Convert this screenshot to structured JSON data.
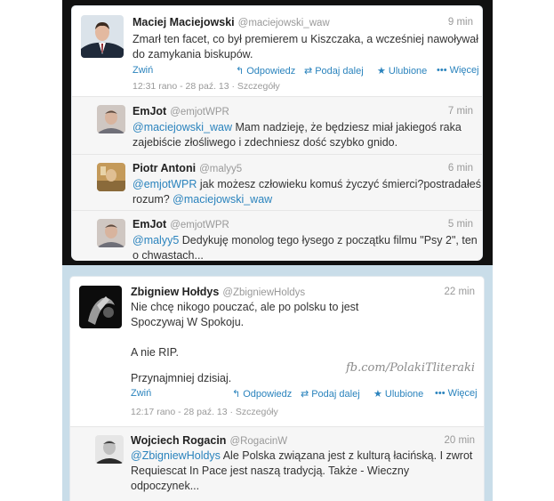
{
  "top_panel": {
    "tweet": {
      "name": "Maciej Maciejowski",
      "handle": "@maciejowski_waw",
      "time": "9 min",
      "line1": "Zmarł ten facet, co był premierem u Kiszczaka, a wcześniej nawoływał",
      "line2": "do zamykania biskupów.",
      "collapse": "Zwiń",
      "reply": "Odpowiedz",
      "retweet": "Podaj dalej",
      "favorite": "Ulubione",
      "more": "Więcej",
      "meta": "12:31 rano - 28 paź. 13 · Szczegóły"
    },
    "replies": [
      {
        "name": "EmJot",
        "handle": "@emjotWPR",
        "time": "7 min",
        "line1_mention": "@maciejowski_waw",
        "line1_text": " Mam nadzieję, że będziesz miał jakiegoś raka",
        "line2": "zajebiście złośliwego i zdechniesz dość szybko gnido."
      },
      {
        "name": "Piotr Antoni",
        "handle": "@malyy5",
        "time": "6 min",
        "line1_mention": "@emjotWPR",
        "line1_text": " jak możesz człowieku komuś życzyć śmierci?postradałeś",
        "line2_text": "rozum? ",
        "line2_mention": "@maciejowski_waw"
      },
      {
        "name": "EmJot",
        "handle": "@emjotWPR",
        "time": "5 min",
        "line1_mention": "@malyy5",
        "line1_text": " Dedykuję monolog tego łysego z początku filmu \"Psy 2\", ten",
        "line2": "o chwastach..."
      }
    ]
  },
  "bottom_panel": {
    "tweet": {
      "name": "Zbigniew Hołdys",
      "handle": "@ZbigniewHoldys",
      "time": "22 min",
      "line1": "Nie chcę nikogo pouczać, ale po polsku to jest",
      "line2": "Spoczywaj W Spokoju.",
      "line3": "A nie RIP.",
      "line4": "Przynajmniej dzisiaj.",
      "watermark": "fb.com/PolakiTliteraki",
      "collapse": "Zwiń",
      "reply": "Odpowiedz",
      "retweet": "Podaj dalej",
      "favorite": "Ulubione",
      "more": "Więcej",
      "meta": "12:17 rano - 28 paź. 13 · Szczegóły"
    },
    "reply": {
      "name": "Wojciech Rogacin",
      "handle": "@RogacinW",
      "time": "20 min",
      "line1_mention": "@ZbigniewHoldys",
      "line1_text": " Ale Polska związana jest z kulturą łacińską. I zwrot",
      "line2": "Requiescat In Pace jest naszą tradycją. Także - Wieczny",
      "line3": "odpoczynek..."
    }
  },
  "icons": {
    "reply": "reply-arrow-icon",
    "retweet": "retweet-icon",
    "favorite": "star-icon",
    "more": "more-dots-icon"
  },
  "colors": {
    "link": "#2a83bd",
    "top_background": "#111111",
    "bottom_background": "#c9dde9"
  }
}
